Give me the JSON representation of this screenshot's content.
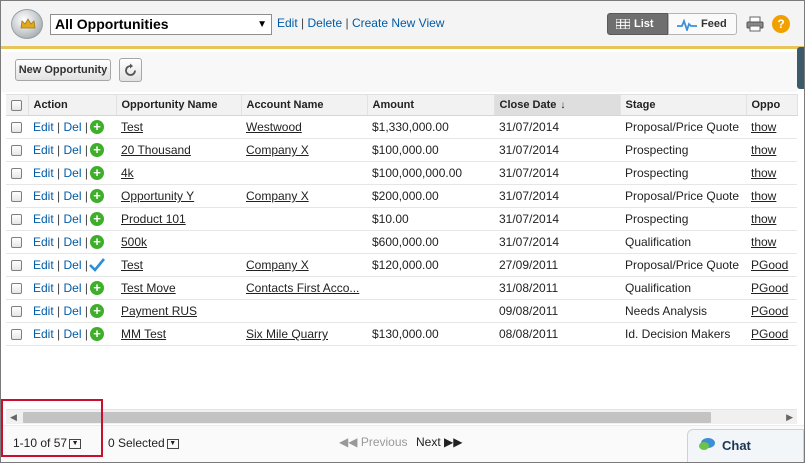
{
  "header": {
    "view_name": "All Opportunities",
    "links": {
      "edit": "Edit",
      "delete": "Delete",
      "create": "Create New View"
    },
    "list_label": "List",
    "feed_label": "Feed",
    "help_label": "?"
  },
  "toolbar": {
    "new_button": "New Opportunity"
  },
  "table": {
    "columns": [
      "Action",
      "Opportunity Name",
      "Account Name",
      "Amount",
      "Close Date",
      "Stage",
      "Oppo"
    ],
    "sort_arrow": "↓",
    "actions": {
      "edit": "Edit",
      "del": "Del"
    },
    "rows": [
      {
        "name": "Test",
        "account": "Westwood",
        "amount": "$1,330,000.00",
        "close": "31/07/2014",
        "stage": "Proposal/Price Quote",
        "owner": "thow",
        "icon": "plus"
      },
      {
        "name": "20 Thousand",
        "account": "Company X",
        "amount": "$100,000.00",
        "close": "31/07/2014",
        "stage": "Prospecting",
        "owner": "thow",
        "icon": "plus"
      },
      {
        "name": "4k",
        "account": "",
        "amount": "$100,000,000.00",
        "close": "31/07/2014",
        "stage": "Prospecting",
        "owner": "thow",
        "icon": "plus"
      },
      {
        "name": "Opportunity Y",
        "account": "Company X",
        "amount": "$200,000.00",
        "close": "31/07/2014",
        "stage": "Proposal/Price Quote",
        "owner": "thow",
        "icon": "plus"
      },
      {
        "name": "Product 101",
        "account": "",
        "amount": "$10.00",
        "close": "31/07/2014",
        "stage": "Prospecting",
        "owner": "thow",
        "icon": "plus"
      },
      {
        "name": "500k",
        "account": "",
        "amount": "$600,000.00",
        "close": "31/07/2014",
        "stage": "Qualification",
        "owner": "thow",
        "icon": "plus"
      },
      {
        "name": "Test",
        "account": "Company X",
        "amount": "$120,000.00",
        "close": "27/09/2011",
        "stage": "Proposal/Price Quote",
        "owner": "PGood",
        "icon": "check"
      },
      {
        "name": "Test Move",
        "account": "Contacts First Acco...",
        "amount": "",
        "close": "31/08/2011",
        "stage": "Qualification",
        "owner": "PGood",
        "icon": "plus"
      },
      {
        "name": "Payment RUS",
        "account": "",
        "amount": "",
        "close": "09/08/2011",
        "stage": "Needs Analysis",
        "owner": "PGood",
        "icon": "plus"
      },
      {
        "name": "MM Test",
        "account": "Six Mile Quarry",
        "amount": "$130,000.00",
        "close": "08/08/2011",
        "stage": "Id. Decision Makers",
        "owner": "PGood",
        "icon": "plus"
      }
    ]
  },
  "footer": {
    "range": "1-10 of 57",
    "selected": "0 Selected",
    "previous": "Previous",
    "next": "Next"
  },
  "chat": {
    "label": "Chat"
  },
  "colors": {
    "accent_bar": "#e8c55b",
    "link": "#015ba7",
    "highlight": "#c8102e",
    "plus_green": "#3fae2a"
  }
}
